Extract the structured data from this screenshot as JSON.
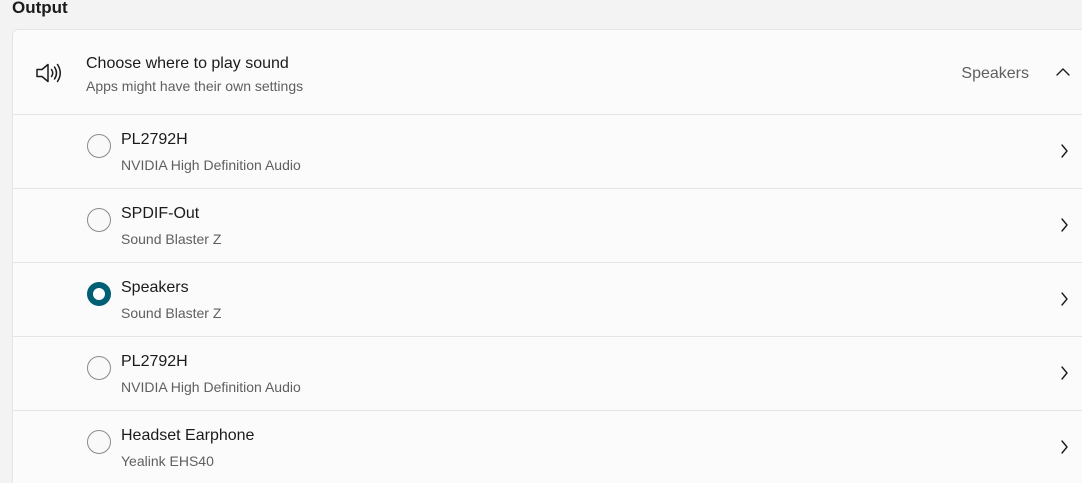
{
  "section": {
    "title": "Output"
  },
  "output_card": {
    "title": "Choose where to play sound",
    "subtitle": "Apps might have their own settings",
    "current_value": "Speakers",
    "icon": "speaker-icon",
    "expand_icon": "chevron-up-icon"
  },
  "devices": [
    {
      "name": "PL2792H",
      "driver": "NVIDIA High Definition Audio",
      "selected": false
    },
    {
      "name": "SPDIF-Out",
      "driver": "Sound Blaster Z",
      "selected": false
    },
    {
      "name": "Speakers",
      "driver": "Sound Blaster Z",
      "selected": true
    },
    {
      "name": "PL2792H",
      "driver": "NVIDIA High Definition Audio",
      "selected": false
    },
    {
      "name": "Headset Earphone",
      "driver": "Yealink EHS40",
      "selected": false
    }
  ],
  "colors": {
    "accent": "#005f73",
    "background": "#f3f3f3",
    "card": "#fbfbfb",
    "secondary_text": "#5f5f5f",
    "divider": "#e5e5e5"
  }
}
